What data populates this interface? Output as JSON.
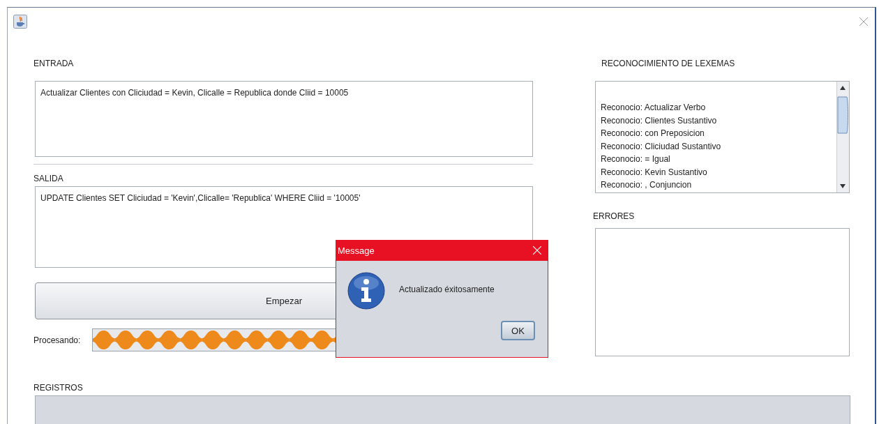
{
  "entrada": {
    "label": "ENTRADA",
    "value": "Actualizar Clientes con Cliciudad = Kevin, Clicalle = Republica donde Cliid = 10005"
  },
  "salida": {
    "label": "SALIDA",
    "value": "UPDATE Clientes SET Cliciudad = 'Kevin',Clicalle= 'Republica' WHERE Cliid = '10005'"
  },
  "start_button": "Empezar",
  "progress": {
    "label": "Procesando:",
    "indeterminate": true
  },
  "lexemas": {
    "label": "RECONOCIMIENTO DE LEXEMAS",
    "lines": [
      "Reconocio: Actualizar Verbo",
      "Reconocio: Clientes Sustantivo",
      "Reconocio: con Preposicion",
      "Reconocio: Cliciudad Sustantivo",
      "Reconocio: = Igual",
      "Reconocio: Kevin Sustantivo",
      "Reconocio: , Conjuncion"
    ]
  },
  "errores": {
    "label": "ERRORES"
  },
  "registros": {
    "label": "REGISTROS"
  },
  "dialog": {
    "title": "Message",
    "message": "Actualizado éxitosamente",
    "ok_button": "OK"
  }
}
